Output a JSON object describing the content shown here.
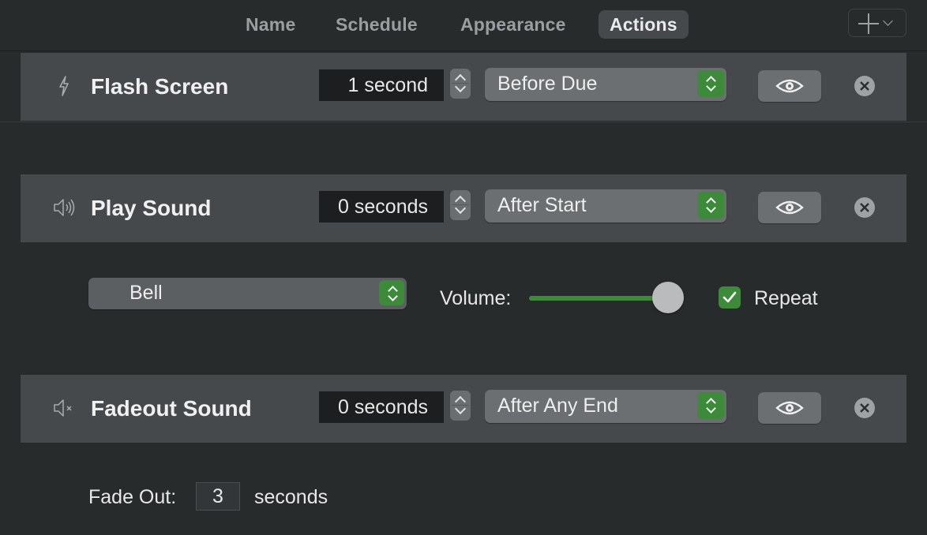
{
  "tabs": [
    {
      "label": "Name"
    },
    {
      "label": "Schedule"
    },
    {
      "label": "Appearance"
    },
    {
      "label": "Actions",
      "active": true
    }
  ],
  "actions": [
    {
      "title": "Flash Screen",
      "icon": "lightning-icon",
      "duration": "1 second",
      "timing": "Before Due"
    },
    {
      "title": "Play Sound",
      "icon": "speaker-icon",
      "duration": "0 seconds",
      "timing": "After Start"
    },
    {
      "title": "Fadeout Sound",
      "icon": "speaker-muted-icon",
      "duration": "0 seconds",
      "timing": "After Any End"
    }
  ],
  "play_sound_options": {
    "sound": "Bell",
    "volume_label": "Volume:",
    "volume_fraction": 0.9,
    "repeat_label": "Repeat",
    "repeat_checked": true
  },
  "fadeout_options": {
    "fade_out_label": "Fade Out:",
    "fade_out_value": "3",
    "unit_label": "seconds"
  },
  "colors": {
    "accent_green": "#3d8a3a",
    "background": "#282b2c",
    "row_background": "#46494b"
  }
}
